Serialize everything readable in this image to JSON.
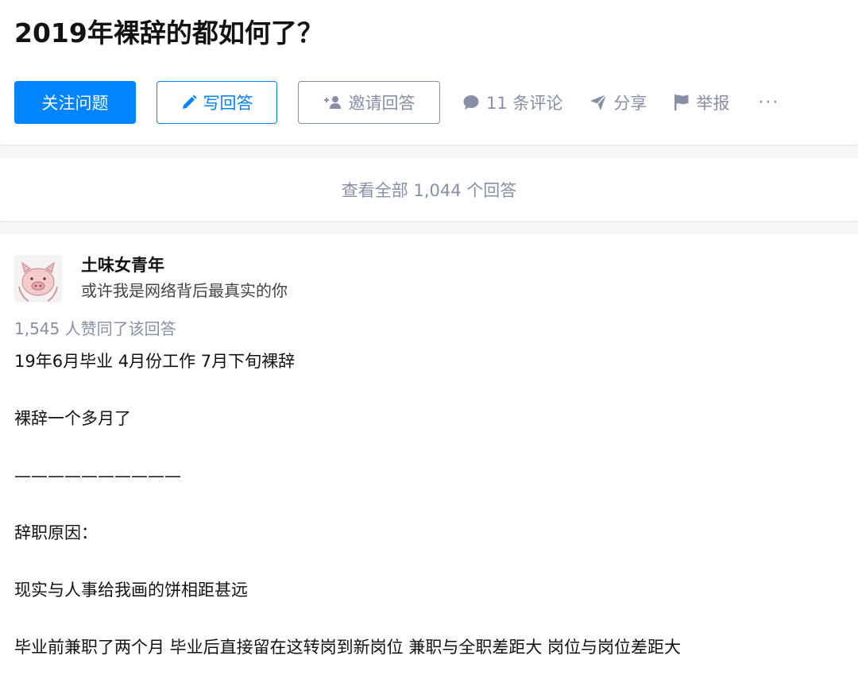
{
  "question": {
    "title": "2019年裸辞的都如何了？"
  },
  "actions": {
    "follow_label": "关注问题",
    "write_label": "写回答",
    "invite_label": "邀请回答",
    "comment_label": "11 条评论",
    "share_label": "分享",
    "report_label": "举报",
    "more_label": "···"
  },
  "view_all": {
    "label": "查看全部 1,044 个回答"
  },
  "answer": {
    "author_name": "土味女青年",
    "author_bio": "或许我是网络背后最真实的你",
    "vote_text": "1,545 人赞同了该回答",
    "paragraphs": [
      "19年6月毕业 4月份工作 7月下旬裸辞",
      "裸辞一个多月了",
      "——————————",
      "辞职原因：",
      "现实与人事给我画的饼相距甚远",
      "毕业前兼职了两个月 毕业后直接留在这转岗到新岗位 兼职与全职差距大 岗位与岗位差距大"
    ]
  },
  "colors": {
    "brand_blue": "#0084ff",
    "muted_gray": "#8590a6",
    "text_dark": "#121212",
    "page_bg": "#f6f6f6"
  },
  "icons": {
    "write": "pencil-icon",
    "invite": "add-person-icon",
    "comment": "speech-bubble-icon",
    "share": "paper-plane-icon",
    "report": "flag-icon",
    "more": "ellipsis-icon"
  }
}
